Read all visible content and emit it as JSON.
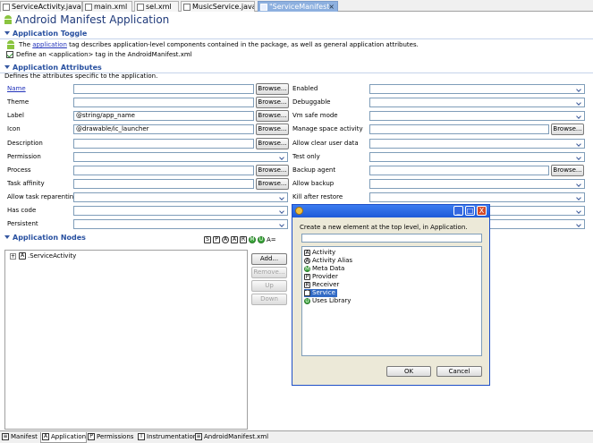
{
  "editor_tabs": [
    {
      "label": "ServiceActivity.java"
    },
    {
      "label": "main.xml"
    },
    {
      "label": "sel.xml"
    },
    {
      "label": "MusicService.java"
    },
    {
      "label": "\"ServiceManifest"
    }
  ],
  "page_title": "Android Manifest Application",
  "toggle": {
    "header": "Application Toggle",
    "desc_prefix": "The",
    "desc_link": "application",
    "desc_suffix": "tag describes application-level components contained in the package, as well as general application attributes.",
    "checkbox_label": "Define an <application> tag in the AndroidManifest.xml"
  },
  "attributes": {
    "header": "Application Attributes",
    "desc": "Defines the attributes specific to the application.",
    "browse_label": "Browse...",
    "left": [
      {
        "label": "Name",
        "kind": "text",
        "value": "",
        "browse": true,
        "link": true
      },
      {
        "label": "Theme",
        "kind": "text",
        "value": "",
        "browse": true
      },
      {
        "label": "Label",
        "kind": "text",
        "value": "@string/app_name",
        "browse": true
      },
      {
        "label": "Icon",
        "kind": "text",
        "value": "@drawable/ic_launcher",
        "browse": true
      },
      {
        "label": "Description",
        "kind": "text",
        "value": "",
        "browse": true
      },
      {
        "label": "Permission",
        "kind": "combo",
        "value": ""
      },
      {
        "label": "Process",
        "kind": "text",
        "value": "",
        "browse": true
      },
      {
        "label": "Task affinity",
        "kind": "text",
        "value": "",
        "browse": true
      },
      {
        "label": "Allow task reparenting",
        "kind": "combo",
        "value": ""
      },
      {
        "label": "Has code",
        "kind": "combo",
        "value": ""
      },
      {
        "label": "Persistent",
        "kind": "combo",
        "value": ""
      }
    ],
    "right": [
      {
        "label": "Enabled",
        "kind": "combo",
        "value": ""
      },
      {
        "label": "Debuggable",
        "kind": "combo",
        "value": ""
      },
      {
        "label": "Vm safe mode",
        "kind": "combo",
        "value": ""
      },
      {
        "label": "Manage space activity",
        "kind": "text",
        "value": "",
        "browse": true
      },
      {
        "label": "Allow clear user data",
        "kind": "combo",
        "value": ""
      },
      {
        "label": "Test only",
        "kind": "combo",
        "value": ""
      },
      {
        "label": "Backup agent",
        "kind": "text",
        "value": "",
        "browse": true
      },
      {
        "label": "Allow backup",
        "kind": "combo",
        "value": ""
      },
      {
        "label": "Kill after restore",
        "kind": "combo",
        "value": ""
      },
      {
        "label": "",
        "kind": "combo",
        "value": ""
      },
      {
        "label": "",
        "kind": "combo",
        "value": ""
      }
    ]
  },
  "nodes": {
    "header": "Application Nodes",
    "sort_label": "A=",
    "filter_icons": [
      "S",
      "P",
      "A",
      "A",
      "R",
      "M",
      "U"
    ],
    "tree_item": {
      "expander": "+",
      "icon_letter": "A",
      "label": ".ServiceActivity"
    },
    "buttons": {
      "add": "Add...",
      "remove": "Remove...",
      "up": "Up",
      "down": "Down"
    }
  },
  "dialog": {
    "prompt": "Create a new element at the top level, in Application.",
    "filter_value": "",
    "items": [
      {
        "icon": "A",
        "label": "Activity"
      },
      {
        "icon": "A",
        "label": "Activity Alias"
      },
      {
        "icon": "M",
        "label": "Meta Data"
      },
      {
        "icon": "P",
        "label": "Provider"
      },
      {
        "icon": "R",
        "label": "Receiver"
      },
      {
        "icon": "S",
        "label": "Service"
      },
      {
        "icon": "U",
        "label": "Uses Library"
      }
    ],
    "selected": "Service",
    "ok": "OK",
    "cancel": "Cancel",
    "minimize": "_",
    "maximize": "□",
    "close": "X"
  },
  "bottom_tabs": [
    {
      "icon": "≡",
      "label": "Manifest"
    },
    {
      "icon": "A",
      "label": "Application"
    },
    {
      "icon": "P",
      "label": "Permissions"
    },
    {
      "icon": "I",
      "label": "Instrumentation"
    },
    {
      "icon": "≡",
      "label": "AndroidManifest.xml"
    }
  ],
  "active_bottom_tab": "Application",
  "colors": {
    "accent": "#2850a0",
    "selection": "#316ac5",
    "dialog_title": "#1e5ad8",
    "tab_active": "#8db0df"
  }
}
